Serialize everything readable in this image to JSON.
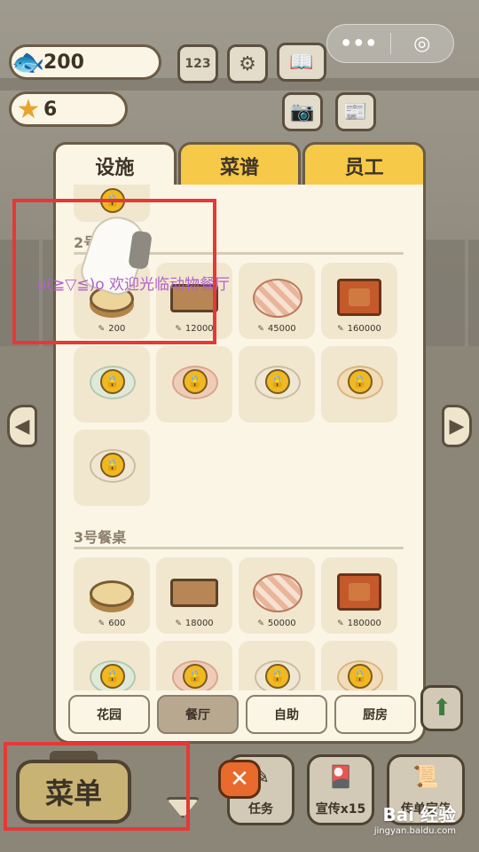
{
  "resources": {
    "fish": "200",
    "stars": "6"
  },
  "top_icons": {
    "ranking": "123",
    "settings": "⚙",
    "book": "📖",
    "camera": "📷",
    "newspaper": "📰"
  },
  "capsule": {
    "more": "•••",
    "close": "◎"
  },
  "tabs": [
    {
      "label": "设施",
      "active": true
    },
    {
      "label": "菜谱",
      "active": false
    },
    {
      "label": "员工",
      "active": false
    }
  ],
  "sections": [
    {
      "title": "2号餐桌",
      "items": [
        {
          "kind": "stump",
          "price": "200"
        },
        {
          "kind": "bench",
          "price": "12000"
        },
        {
          "kind": "cloth",
          "price": "45000"
        },
        {
          "kind": "rug",
          "price": "160000"
        },
        {
          "kind": "locked",
          "plate": "g"
        },
        {
          "kind": "locked",
          "plate": "p"
        },
        {
          "kind": "locked",
          "plate": "w"
        },
        {
          "kind": "locked",
          "plate": "o"
        },
        {
          "kind": "locked",
          "plate": "w"
        }
      ]
    },
    {
      "title": "3号餐桌",
      "items": [
        {
          "kind": "stump",
          "price": "600"
        },
        {
          "kind": "bench",
          "price": "18000"
        },
        {
          "kind": "cloth",
          "price": "50000"
        },
        {
          "kind": "rug",
          "price": "180000"
        },
        {
          "kind": "locked",
          "plate": "g"
        },
        {
          "kind": "locked",
          "plate": "p"
        },
        {
          "kind": "locked",
          "plate": "w"
        },
        {
          "kind": "locked",
          "plate": "o"
        }
      ]
    }
  ],
  "subtabs": [
    {
      "label": "花园",
      "active": false
    },
    {
      "label": "餐厅",
      "active": true
    },
    {
      "label": "自助",
      "active": false
    },
    {
      "label": "厨房",
      "active": false
    }
  ],
  "bottom": {
    "menu": "菜单",
    "task": "任务",
    "promo": "宣传x15",
    "flyer": "传单宣传",
    "close_glyph": "✕"
  },
  "overlay_text": "o(≧▽≦)o 欢迎光临动物餐厅",
  "watermark": {
    "brand": "Bai 经验",
    "url": "jingyan.baidu.com"
  },
  "colors": {
    "accent_tab": "#f7c949",
    "panel": "#fbf5e6",
    "border": "#6a5c46",
    "coin": "#f1b824",
    "close_red": "#e86a2c",
    "annotation_red": "#e53935"
  }
}
